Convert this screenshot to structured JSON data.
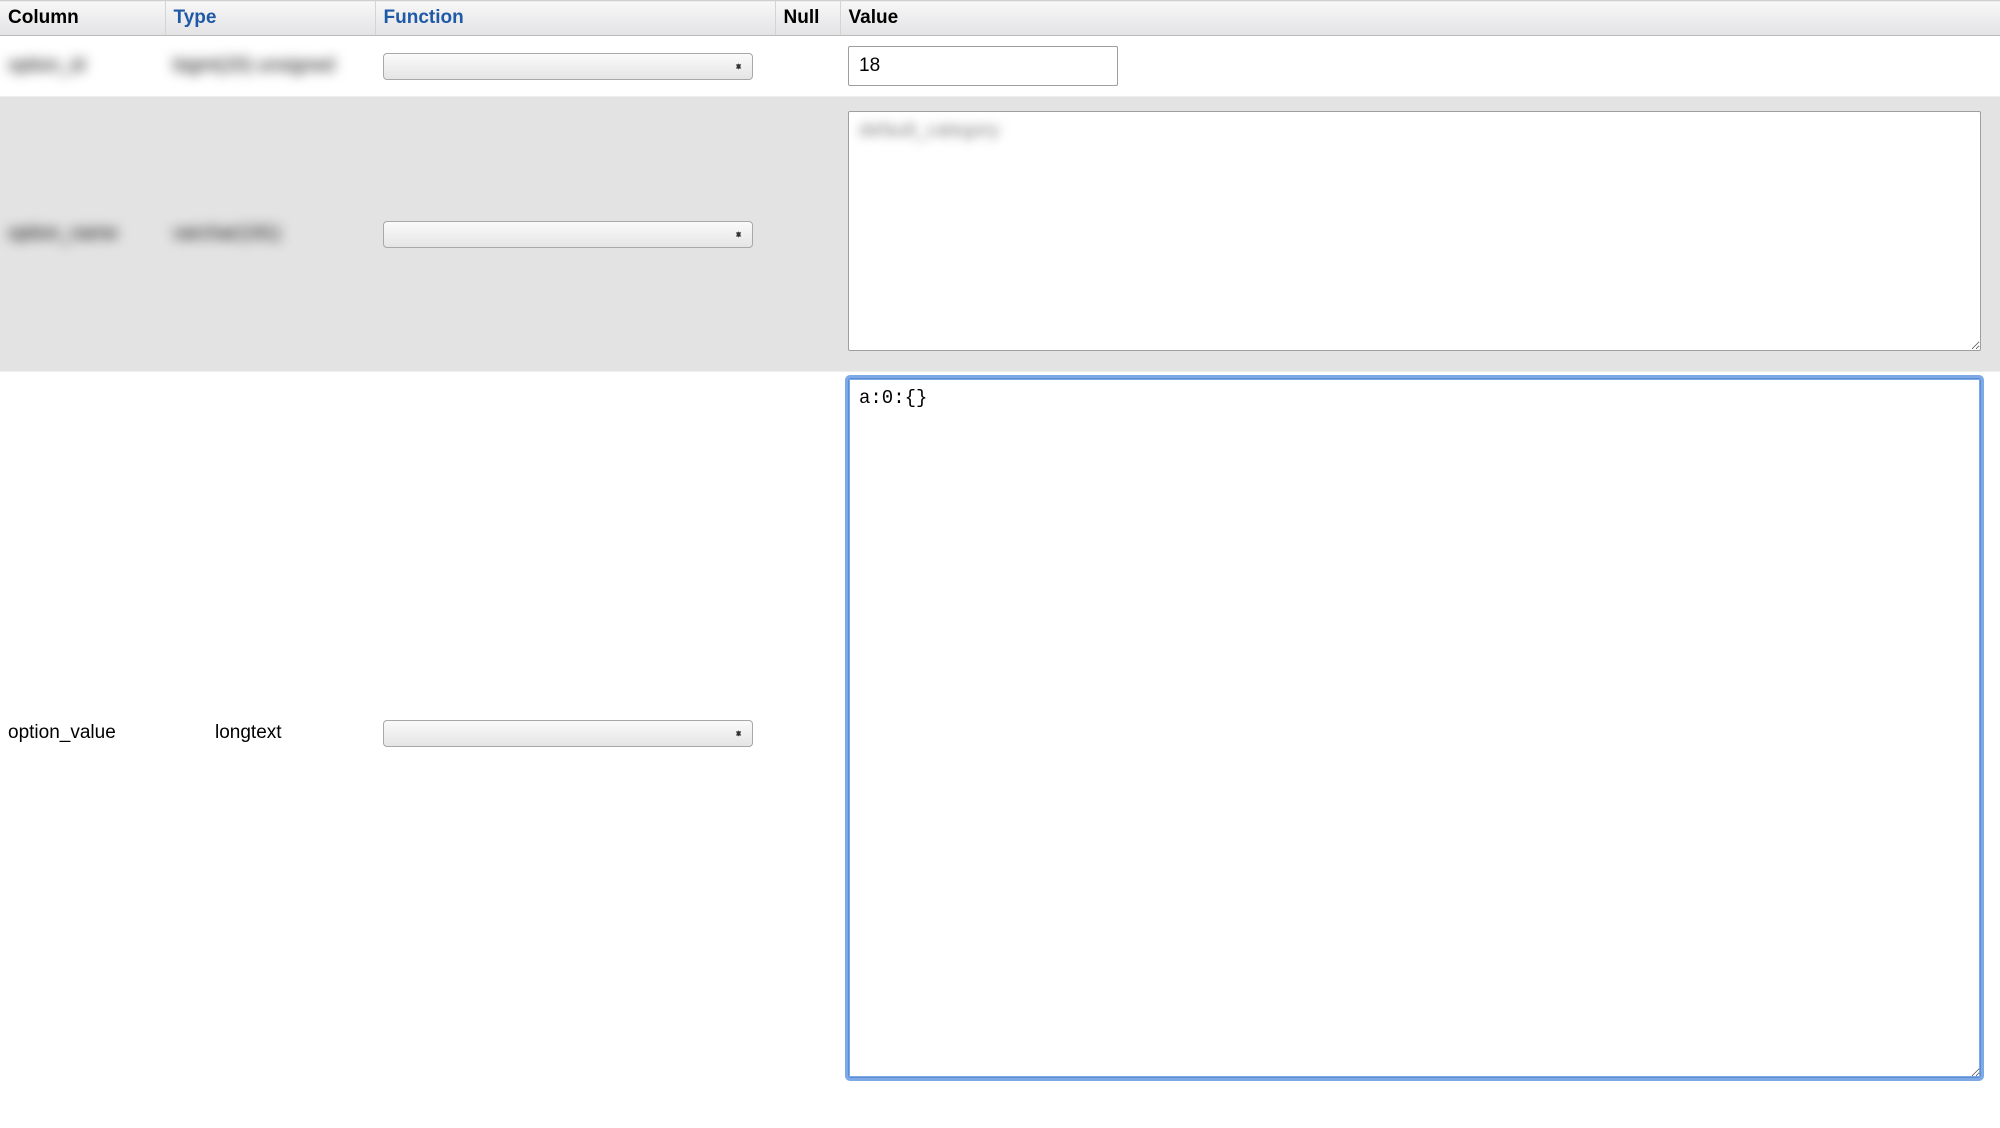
{
  "headers": {
    "column": "Column",
    "type": "Type",
    "function": "Function",
    "null": "Null",
    "value": "Value"
  },
  "rows": [
    {
      "column": "option_id",
      "type": "bigint(20) unsigned",
      "function": "",
      "null": "",
      "value": "18",
      "blurred": true,
      "value_kind": "input"
    },
    {
      "column": "option_name",
      "type": "varchar(191)",
      "function": "",
      "null": "",
      "value": "default_category",
      "blurred": true,
      "value_kind": "textarea"
    },
    {
      "column": "option_value",
      "type": "longtext",
      "function": "",
      "null": "",
      "value": "a:0:{}",
      "blurred": false,
      "value_kind": "textarea_focused"
    }
  ]
}
